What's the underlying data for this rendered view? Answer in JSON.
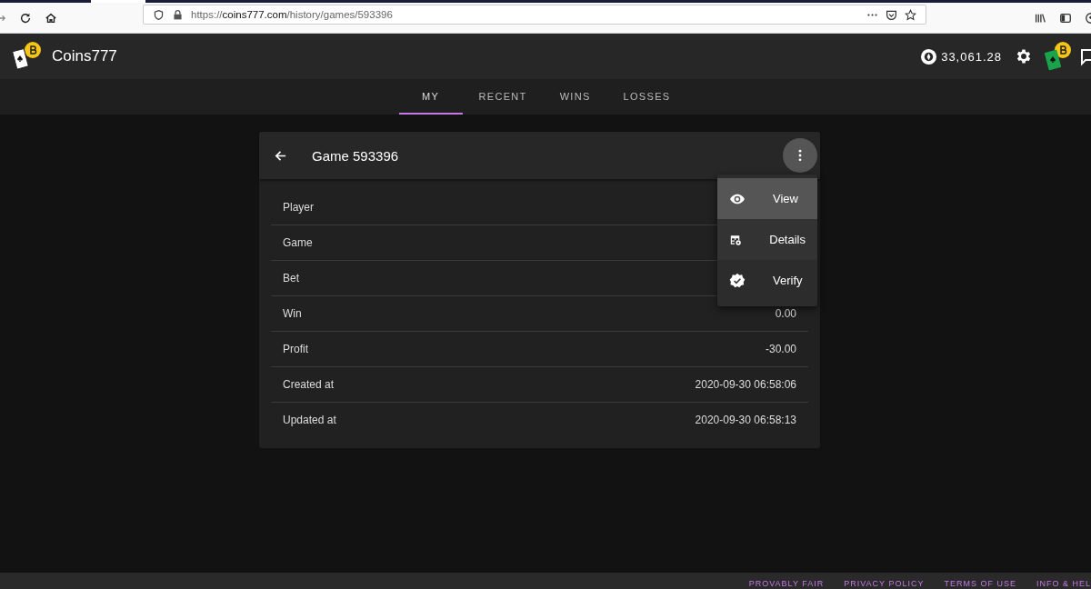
{
  "browser": {
    "url_scheme": "https://",
    "url_domain": "coins777.com",
    "url_path": "/history/games/593396"
  },
  "app": {
    "name": "Coins777",
    "balance": "33,061.28"
  },
  "tabs": [
    {
      "label": "MY",
      "selected": true
    },
    {
      "label": "RECENT",
      "selected": false
    },
    {
      "label": "WINS",
      "selected": false
    },
    {
      "label": "LOSSES",
      "selected": false
    }
  ],
  "card": {
    "title": "Game 593396",
    "rows": [
      {
        "label": "Player"
      },
      {
        "label": "Game"
      },
      {
        "label": "Bet"
      },
      {
        "label": "Win",
        "value": "0.00"
      },
      {
        "label": "Profit",
        "value": "-30.00"
      },
      {
        "label": "Created at",
        "value": "2020-09-30 06:58:06"
      },
      {
        "label": "Updated at",
        "value": "2020-09-30 06:58:13"
      }
    ]
  },
  "menu": {
    "items": [
      {
        "kind": "view",
        "label": "View",
        "selected": true
      },
      {
        "kind": "details",
        "label": "Details",
        "selected": false
      },
      {
        "kind": "verify",
        "label": "Verify",
        "selected": false
      }
    ]
  },
  "footer": {
    "links": [
      "PROVABLY FAIR",
      "PRIVACY POLICY",
      "TERMS OF USE",
      "INFO & HEL"
    ]
  }
}
